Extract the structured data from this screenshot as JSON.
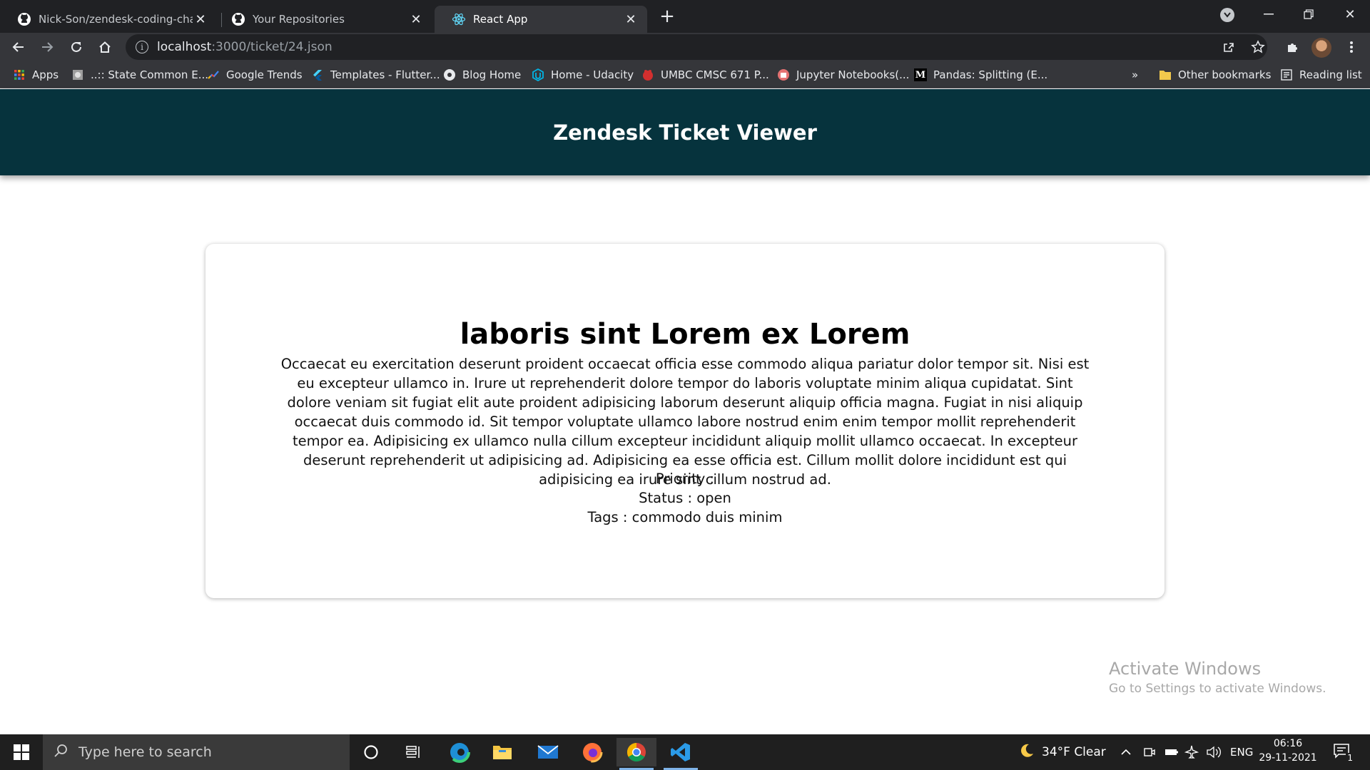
{
  "browser": {
    "tabs": [
      {
        "title": "Nick-Son/zendesk-coding-challe",
        "favicon": "github-icon",
        "active": false
      },
      {
        "title": "Your Repositories",
        "favicon": "github-icon",
        "active": false
      },
      {
        "title": "React App",
        "favicon": "react-icon",
        "active": true
      }
    ],
    "address": {
      "host": "localhost",
      "path": ":3000/ticket/24.json"
    },
    "bookmarks": [
      {
        "label": "Apps",
        "icon": "apps-grid-icon"
      },
      {
        "label": "..:: State Common E...",
        "icon": "state-icon"
      },
      {
        "label": "Google Trends",
        "icon": "google-trends-icon"
      },
      {
        "label": "Templates - Flutter...",
        "icon": "flutter-icon"
      },
      {
        "label": "Blog Home",
        "icon": "blog-icon"
      },
      {
        "label": "Home - Udacity",
        "icon": "udacity-icon"
      },
      {
        "label": "UMBC CMSC 671 P...",
        "icon": "umbc-icon"
      },
      {
        "label": "Jupyter Notebooks(...",
        "icon": "jupyter-icon"
      },
      {
        "label": "Pandas: Splitting (E...",
        "icon": "medium-icon"
      }
    ],
    "overflow_label": "»",
    "other_bookmarks": "Other bookmarks",
    "reading_list": "Reading list"
  },
  "page": {
    "header_title": "Zendesk Ticket Viewer",
    "ticket": {
      "subject": "laboris sint Lorem ex Lorem",
      "description": "Occaecat eu exercitation deserunt proident occaecat officia esse commodo aliqua pariatur dolor tempor sit. Nisi est eu excepteur ullamco in. Irure ut reprehenderit dolore tempor do laboris voluptate minim aliqua cupidatat. Sint dolore veniam sit fugiat elit aute proident adipisicing laborum deserunt aliquip officia magna. Fugiat in nisi aliquip occaecat duis commodo id. Sit tempor voluptate ullamco labore nostrud enim enim tempor mollit reprehenderit tempor ea. Adipisicing ex ullamco nulla cillum excepteur incididunt aliquip mollit ullamco occaecat. In excepteur deserunt reprehenderit ut adipisicing ad. Adipisicing ea esse officia est. Cillum mollit dolore incididunt est qui adipisicing ea irure sint cillum nostrud ad.",
      "priority_line": "Priority :",
      "status_line": "Status : open",
      "tags_line": "Tags : commodo duis minim"
    },
    "watermark": {
      "line1": "Activate Windows",
      "line2": "Go to Settings to activate Windows."
    }
  },
  "taskbar": {
    "search_placeholder": "Type here to search",
    "weather": "34°F  Clear",
    "language": "ENG",
    "time": "06:16",
    "date": "29-11-2021",
    "notification_count": "1"
  },
  "colors": {
    "header_bg": "#06333d",
    "chrome_dark": "#202124",
    "chrome_toolbar": "#35363a",
    "taskbar": "#1f1f1f"
  }
}
